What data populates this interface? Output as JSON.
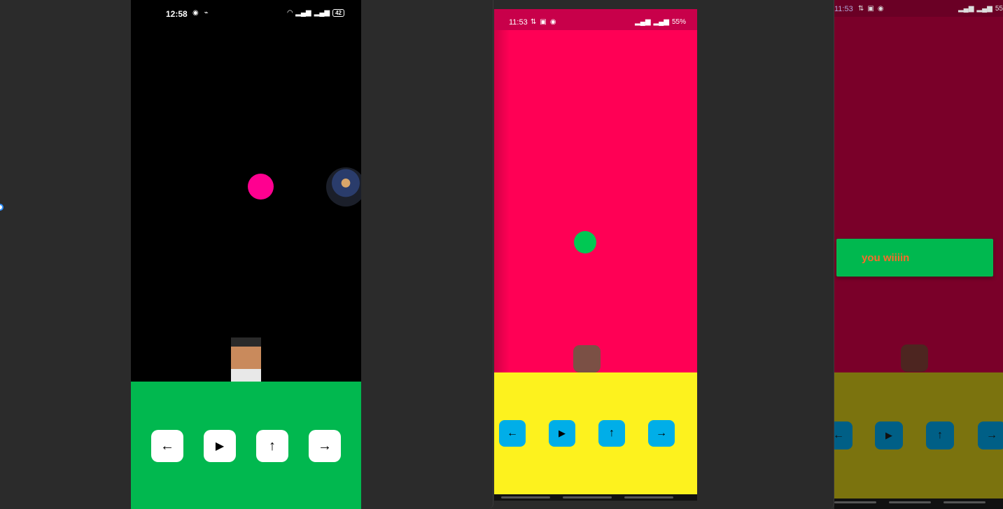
{
  "phone1": {
    "status": {
      "time": "12:58",
      "battery": "42"
    },
    "ball_color": "#ff0090",
    "background": "#000000",
    "controls_color": "#01b84f",
    "buttons": [
      {
        "icon": "arrow-left-icon",
        "glyph": "←"
      },
      {
        "icon": "play-icon",
        "glyph": "▶"
      },
      {
        "icon": "arrow-up-icon",
        "glyph": "↑"
      },
      {
        "icon": "arrow-right-icon",
        "glyph": "→"
      }
    ]
  },
  "phone2": {
    "status": {
      "time": "11:53",
      "battery": "55%"
    },
    "ball_color": "#00c853",
    "background": "#ff0055",
    "controls_color": "#fdf21e",
    "player_color": "#7b5045",
    "buttons": [
      {
        "icon": "arrow-left-icon",
        "glyph": "←"
      },
      {
        "icon": "play-icon",
        "glyph": "▶"
      },
      {
        "icon": "arrow-up-icon",
        "glyph": "↑"
      },
      {
        "icon": "arrow-right-icon",
        "glyph": "→"
      }
    ]
  },
  "phone3": {
    "status": {
      "time": "11:53",
      "battery": "55"
    },
    "toast_text": "you wiiiin",
    "buttons": [
      {
        "icon": "arrow-left-icon",
        "glyph": "←"
      },
      {
        "icon": "play-icon",
        "glyph": "▶"
      },
      {
        "icon": "arrow-up-icon",
        "glyph": "↑"
      },
      {
        "icon": "arrow-right-icon",
        "glyph": "→"
      }
    ]
  }
}
